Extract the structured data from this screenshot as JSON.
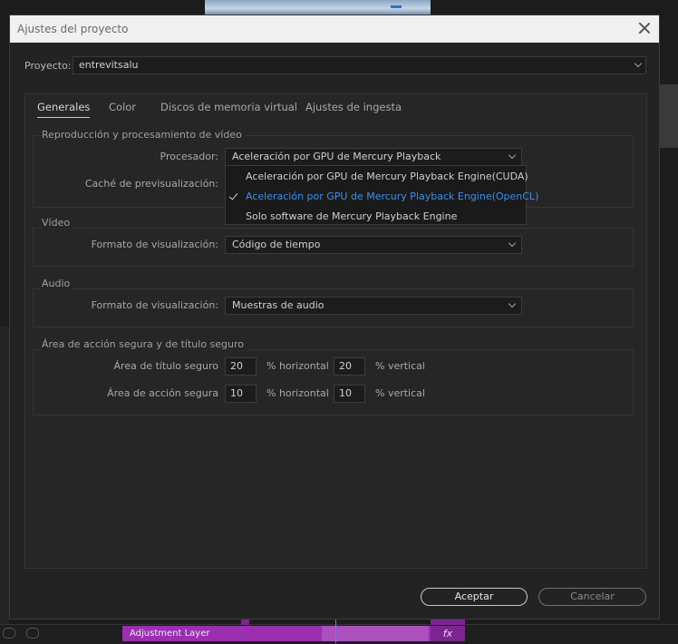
{
  "dialog": {
    "title": "Ajustes del proyecto",
    "project_label": "Proyecto:",
    "project_value": "entrevitsalu",
    "tabs": [
      "Generales",
      "Color",
      "Discos de memoria virtual",
      "Ajustes de ingesta"
    ],
    "active_tab": "Generales",
    "groups": {
      "playback": {
        "title": "Reproducción y procesamiento de vídeo",
        "renderer_label": "Procesador:",
        "renderer_value": "Aceleración por GPU de Mercury Playback Engine(OpenCL)",
        "preview_cache_label": "Caché de previsualización:",
        "renderer_options": [
          "Aceleración por GPU de Mercury Playback Engine(CUDA)",
          "Aceleración por GPU de Mercury Playback Engine(OpenCL)",
          "Solo software de Mercury Playback Engine"
        ],
        "selected_option_index": 1
      },
      "video": {
        "title": "Vídeo",
        "display_format_label": "Formato de visualización:",
        "display_format_value": "Código de tiempo"
      },
      "audio": {
        "title": "Audio",
        "display_format_label": "Formato de visualización:",
        "display_format_value": "Muestras de audio"
      },
      "safe_areas": {
        "title": "Área de acción segura y de título seguro",
        "title_safe_label": "Área de título seguro",
        "title_safe_h": "20",
        "title_safe_v": "20",
        "action_safe_label": "Área de acción segura",
        "action_safe_h": "10",
        "action_safe_v": "10",
        "horizontal_unit": "% horizontal",
        "vertical_unit": "% vertical"
      }
    },
    "buttons": {
      "ok": "Aceptar",
      "cancel": "Cancelar"
    }
  },
  "timeline": {
    "clip_label": "Adjustment Layer",
    "fx_label": "fx"
  },
  "colors": {
    "accent": "#3d8ef0",
    "clip": "#9a2fb0"
  }
}
